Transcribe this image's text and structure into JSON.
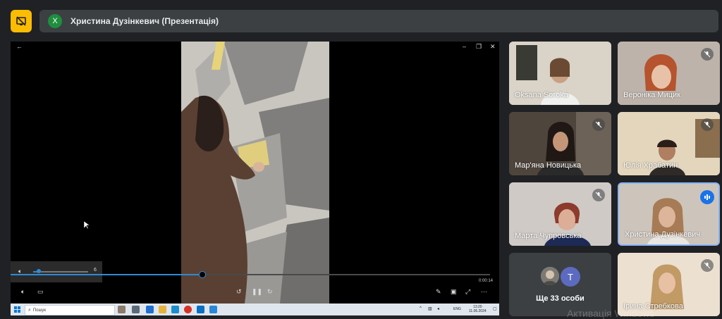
{
  "presenter": {
    "avatar_letter": "Х",
    "name": "Христина Дузінкевич (Презентація)"
  },
  "player": {
    "time": "0:00:14",
    "volume_value": "6",
    "progress_fraction": 0.4,
    "volume_fraction": 0.1
  },
  "taskbar": {
    "search_placeholder": "Пошук",
    "language": "ENG",
    "clock_time": "13:20",
    "clock_date": "11.06.2024"
  },
  "participants": [
    {
      "name": "Oksana Soroka",
      "muted": false
    },
    {
      "name": "Вероніка Мицик",
      "muted": true
    },
    {
      "name": "Мар'яна Новицька",
      "muted": true
    },
    {
      "name": "Юлія Храбатин",
      "muted": true
    },
    {
      "name": "Марта Чупровська",
      "muted": true
    },
    {
      "name": "Христина Дузінкевич",
      "muted": false,
      "speaking": true
    },
    {
      "name": "Ірина Стребкова",
      "muted": true
    }
  ],
  "others_tile": {
    "avatar_letter": "T",
    "label": "Ще 33 особи"
  },
  "watermark": "Активація Windows",
  "colors": {
    "background": "#202124",
    "tile": "#3c4043",
    "accent_yellow": "#fbbc04",
    "speaking_blue": "#1a73e8",
    "progress_blue": "#2f8ad6"
  }
}
